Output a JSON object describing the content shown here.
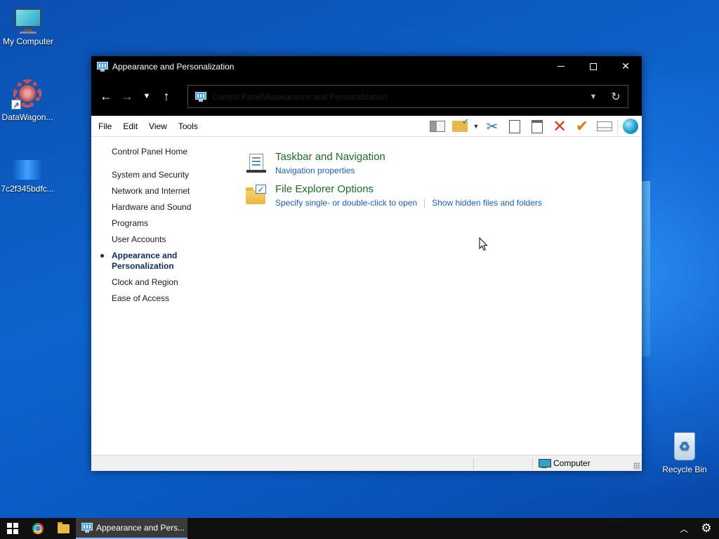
{
  "desktop": {
    "icons": [
      {
        "label": "My Computer"
      },
      {
        "label": "DataWagon..."
      },
      {
        "label": "7c2f345bdfc..."
      },
      {
        "label": "Recycle Bin"
      }
    ]
  },
  "window": {
    "title": "Appearance and Personalization",
    "address_path": "Control Panel\\Appearance and Personalization"
  },
  "menubar": {
    "items": [
      "File",
      "Edit",
      "View",
      "Tools"
    ]
  },
  "sidebar": {
    "home": "Control Panel Home",
    "items": [
      {
        "label": "System and Security",
        "active": false
      },
      {
        "label": "Network and Internet",
        "active": false
      },
      {
        "label": "Hardware and Sound",
        "active": false
      },
      {
        "label": "Programs",
        "active": false
      },
      {
        "label": "User Accounts",
        "active": false
      },
      {
        "label": "Appearance and Personalization",
        "active": true
      },
      {
        "label": "Clock and Region",
        "active": false
      },
      {
        "label": "Ease of Access",
        "active": false
      }
    ]
  },
  "main": {
    "sections": [
      {
        "title": "Taskbar and Navigation",
        "icon": "taskbar-navigation-icon",
        "links": [
          "Navigation properties"
        ]
      },
      {
        "title": "File Explorer Options",
        "icon": "folder-options-icon",
        "links": [
          "Specify single- or double-click to open",
          "Show hidden files and folders"
        ]
      }
    ]
  },
  "statusbar": {
    "location": "Computer"
  },
  "taskbar": {
    "active_task": "Appearance and Pers..."
  },
  "colors": {
    "section_title": "#1e6b21",
    "link": "#1a5fb4",
    "titlebar": "#000000",
    "desktop": "#0d64cc"
  }
}
